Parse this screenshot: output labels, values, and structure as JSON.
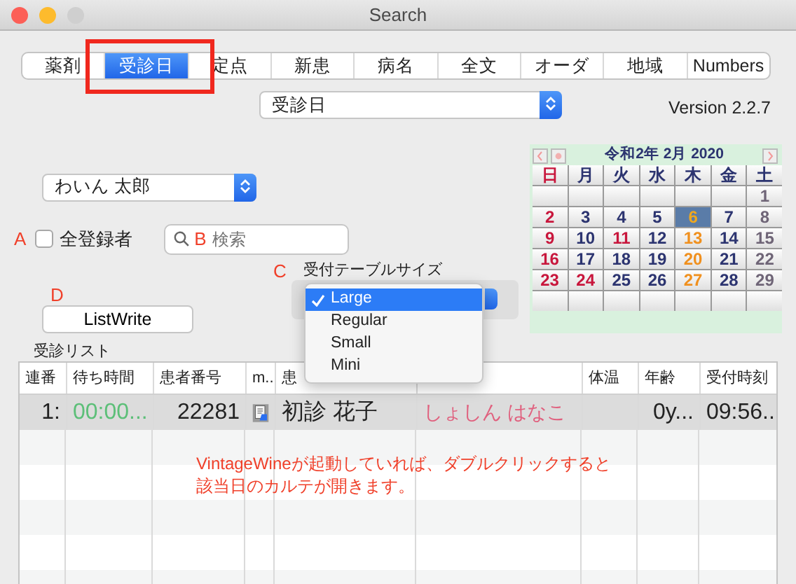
{
  "window": {
    "title": "Search"
  },
  "tabs": [
    {
      "label": "薬剤",
      "selected": false
    },
    {
      "label": "受診日",
      "selected": true
    },
    {
      "label": "定点",
      "selected": false
    },
    {
      "label": "新患",
      "selected": false
    },
    {
      "label": "病名",
      "selected": false
    },
    {
      "label": "全文",
      "selected": false
    },
    {
      "label": "オーダ",
      "selected": false
    },
    {
      "label": "地域",
      "selected": false
    },
    {
      "label": "Numbers",
      "selected": false
    }
  ],
  "mode_popup": {
    "value": "受診日"
  },
  "version": "Version 2.2.7",
  "patient_popup": {
    "value": "わいん 太郎"
  },
  "all_registered": {
    "label": "全登録者",
    "checked": false
  },
  "search": {
    "placeholder": "検索"
  },
  "table_size": {
    "label": "受付テーブルサイズ",
    "options": [
      {
        "label": "Large",
        "selected": true
      },
      {
        "label": "Regular",
        "selected": false
      },
      {
        "label": "Small",
        "selected": false
      },
      {
        "label": "Mini",
        "selected": false
      }
    ]
  },
  "list_write_button": "ListWrite",
  "annotations": [
    "A",
    "B",
    "C",
    "D"
  ],
  "calendar": {
    "title": "令和2年 2月 2020",
    "weekdays": [
      {
        "label": "日",
        "color": "#c8163c"
      },
      {
        "label": "月",
        "color": "#2c3470"
      },
      {
        "label": "火",
        "color": "#2c3470"
      },
      {
        "label": "水",
        "color": "#2c3470"
      },
      {
        "label": "木",
        "color": "#2c3470"
      },
      {
        "label": "金",
        "color": "#2c3470"
      },
      {
        "label": "土",
        "color": "#2c3470"
      }
    ],
    "weeks": [
      [
        {
          "kind": "empty"
        },
        {
          "kind": "empty"
        },
        {
          "kind": "empty"
        },
        {
          "kind": "empty"
        },
        {
          "kind": "empty"
        },
        {
          "kind": "empty"
        },
        {
          "kind": "day",
          "day": "1",
          "color": "#6f6577",
          "selected": false
        }
      ],
      [
        {
          "kind": "day",
          "day": "2",
          "color": "#c8163c",
          "selected": false
        },
        {
          "kind": "day",
          "day": "3",
          "color": "#2c3470",
          "selected": false
        },
        {
          "kind": "day",
          "day": "4",
          "color": "#2c3470",
          "selected": false
        },
        {
          "kind": "day",
          "day": "5",
          "color": "#2c3470",
          "selected": false
        },
        {
          "kind": "day",
          "day": "6",
          "color": "#f0a81e",
          "selected": true
        },
        {
          "kind": "day",
          "day": "7",
          "color": "#2c3470",
          "selected": false
        },
        {
          "kind": "day",
          "day": "8",
          "color": "#6f6577",
          "selected": false
        }
      ],
      [
        {
          "kind": "day",
          "day": "9",
          "color": "#c8163c",
          "selected": false
        },
        {
          "kind": "day",
          "day": "10",
          "color": "#2c3470",
          "selected": false
        },
        {
          "kind": "day",
          "day": "11",
          "color": "#c8163c",
          "selected": false
        },
        {
          "kind": "day",
          "day": "12",
          "color": "#2c3470",
          "selected": false
        },
        {
          "kind": "day",
          "day": "13",
          "color": "#f0901e",
          "selected": false
        },
        {
          "kind": "day",
          "day": "14",
          "color": "#2c3470",
          "selected": false
        },
        {
          "kind": "day",
          "day": "15",
          "color": "#6f6577",
          "selected": false
        }
      ],
      [
        {
          "kind": "day",
          "day": "16",
          "color": "#c8163c",
          "selected": false
        },
        {
          "kind": "day",
          "day": "17",
          "color": "#2c3470",
          "selected": false
        },
        {
          "kind": "day",
          "day": "18",
          "color": "#2c3470",
          "selected": false
        },
        {
          "kind": "day",
          "day": "19",
          "color": "#2c3470",
          "selected": false
        },
        {
          "kind": "day",
          "day": "20",
          "color": "#f0901e",
          "selected": false
        },
        {
          "kind": "day",
          "day": "21",
          "color": "#2c3470",
          "selected": false
        },
        {
          "kind": "day",
          "day": "22",
          "color": "#6f6577",
          "selected": false
        }
      ],
      [
        {
          "kind": "day",
          "day": "23",
          "color": "#c8163c",
          "selected": false
        },
        {
          "kind": "day",
          "day": "24",
          "color": "#c8163c",
          "selected": false
        },
        {
          "kind": "day",
          "day": "25",
          "color": "#2c3470",
          "selected": false
        },
        {
          "kind": "day",
          "day": "26",
          "color": "#2c3470",
          "selected": false
        },
        {
          "kind": "day",
          "day": "27",
          "color": "#f0901e",
          "selected": false
        },
        {
          "kind": "day",
          "day": "28",
          "color": "#2c3470",
          "selected": false
        },
        {
          "kind": "day",
          "day": "29",
          "color": "#6f6577",
          "selected": false
        }
      ],
      [
        {
          "kind": "empty"
        },
        {
          "kind": "empty"
        },
        {
          "kind": "empty"
        },
        {
          "kind": "empty"
        },
        {
          "kind": "empty"
        },
        {
          "kind": "empty"
        },
        {
          "kind": "empty"
        }
      ]
    ]
  },
  "list_title": "受診リスト",
  "table": {
    "columns": [
      {
        "kind": "label",
        "label": "連番"
      },
      {
        "kind": "label",
        "label": "待ち時間"
      },
      {
        "kind": "label",
        "label": "患者番号"
      },
      {
        "kind": "label",
        "label": "m..."
      },
      {
        "kind": "label",
        "label": "患"
      },
      {
        "kind": "blank"
      },
      {
        "kind": "label",
        "label": "体温"
      },
      {
        "kind": "label",
        "label": "年齢"
      },
      {
        "kind": "label",
        "label": "受付時刻"
      }
    ],
    "rows": [
      {
        "selected": true,
        "cells": [
          "1:",
          "00:00...",
          "22281",
          "",
          "初診 花子",
          "しょしん はなこ",
          "",
          "0y...",
          "09:56..."
        ]
      }
    ]
  },
  "note": "VintageWineが起動していれば、ダブルクリックすると該当日のカルテが開きます。"
}
